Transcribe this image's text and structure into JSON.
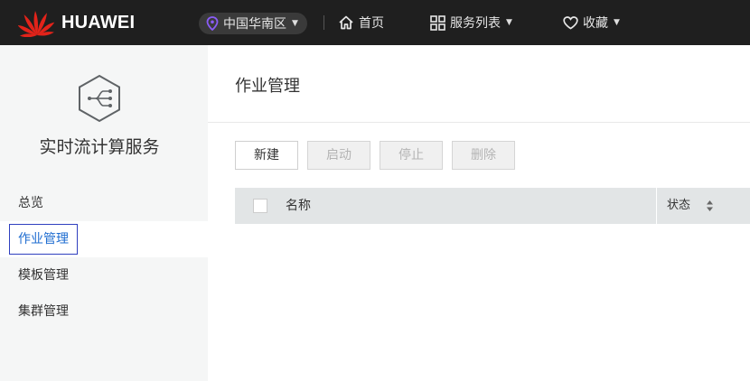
{
  "header": {
    "brand": "HUAWEI",
    "region": "中国华南区",
    "nav": [
      {
        "label": "首页",
        "icon": "home-icon"
      },
      {
        "label": "服务列表",
        "icon": "grid-icon"
      },
      {
        "label": "收藏",
        "icon": "heart-icon"
      }
    ],
    "colors": {
      "bar": "#1f1f1f",
      "region_pin": "#8a5cf6"
    }
  },
  "sidebar": {
    "service_name": "实时流计算服务",
    "service_icon": "stream-hexagon-icon",
    "items": [
      {
        "label": "总览",
        "active": false
      },
      {
        "label": "作业管理",
        "active": true
      },
      {
        "label": "模板管理",
        "active": false
      },
      {
        "label": "集群管理",
        "active": false
      }
    ]
  },
  "main": {
    "title": "作业管理",
    "toolbar": {
      "create": "新建",
      "start": "启动",
      "stop": "停止",
      "delete": "删除"
    },
    "table": {
      "columns": [
        "名称",
        "状态"
      ]
    }
  }
}
